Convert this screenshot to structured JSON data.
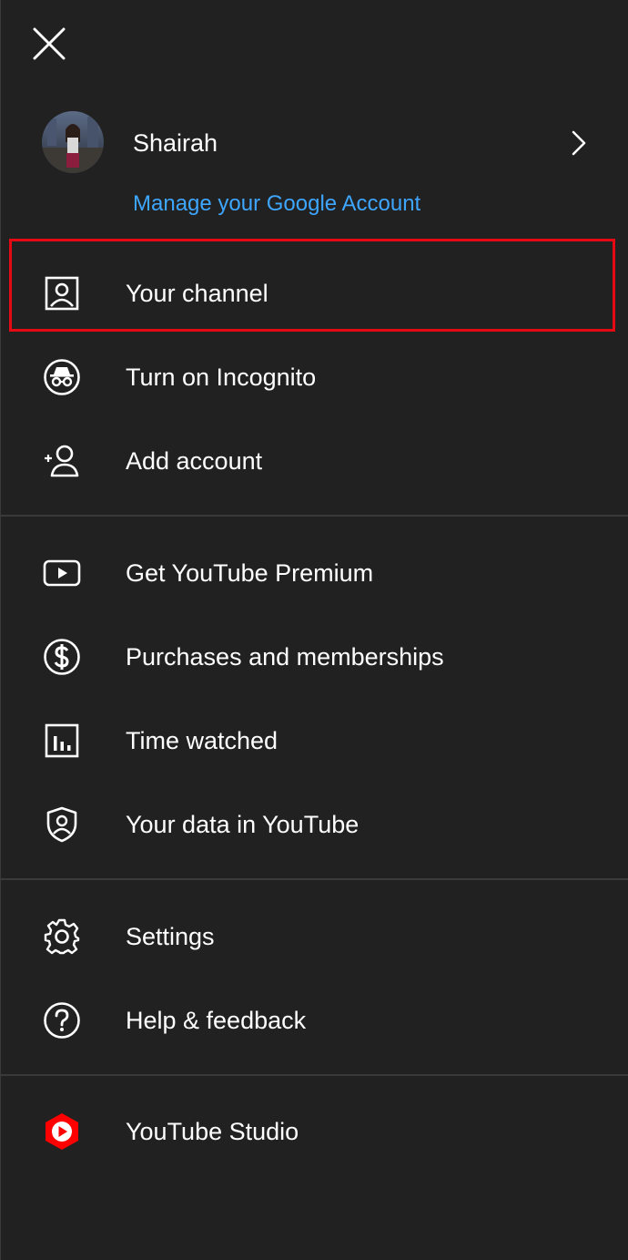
{
  "account": {
    "name": "Shairah",
    "manage_link": "Manage your Google Account"
  },
  "menu": {
    "section1": [
      {
        "id": "your-channel",
        "label": "Your channel",
        "icon": "person-box-icon"
      },
      {
        "id": "incognito",
        "label": "Turn on Incognito",
        "icon": "incognito-icon"
      },
      {
        "id": "add-account",
        "label": "Add account",
        "icon": "add-person-icon"
      }
    ],
    "section2": [
      {
        "id": "premium",
        "label": "Get YouTube Premium",
        "icon": "youtube-play-icon"
      },
      {
        "id": "purchases",
        "label": "Purchases and memberships",
        "icon": "dollar-circle-icon"
      },
      {
        "id": "time-watched",
        "label": "Time watched",
        "icon": "bar-chart-icon"
      },
      {
        "id": "your-data",
        "label": "Your data in YouTube",
        "icon": "shield-person-icon"
      }
    ],
    "section3": [
      {
        "id": "settings",
        "label": "Settings",
        "icon": "gear-icon"
      },
      {
        "id": "help",
        "label": "Help & feedback",
        "icon": "help-circle-icon"
      }
    ],
    "section4": [
      {
        "id": "studio",
        "label": "YouTube Studio",
        "icon": "youtube-studio-icon"
      }
    ]
  },
  "colors": {
    "background": "#212121",
    "text": "#ffffff",
    "link": "#3ea6ff",
    "highlight": "#e50914",
    "studio_red": "#ff0000",
    "divider": "#3a3a3a"
  }
}
